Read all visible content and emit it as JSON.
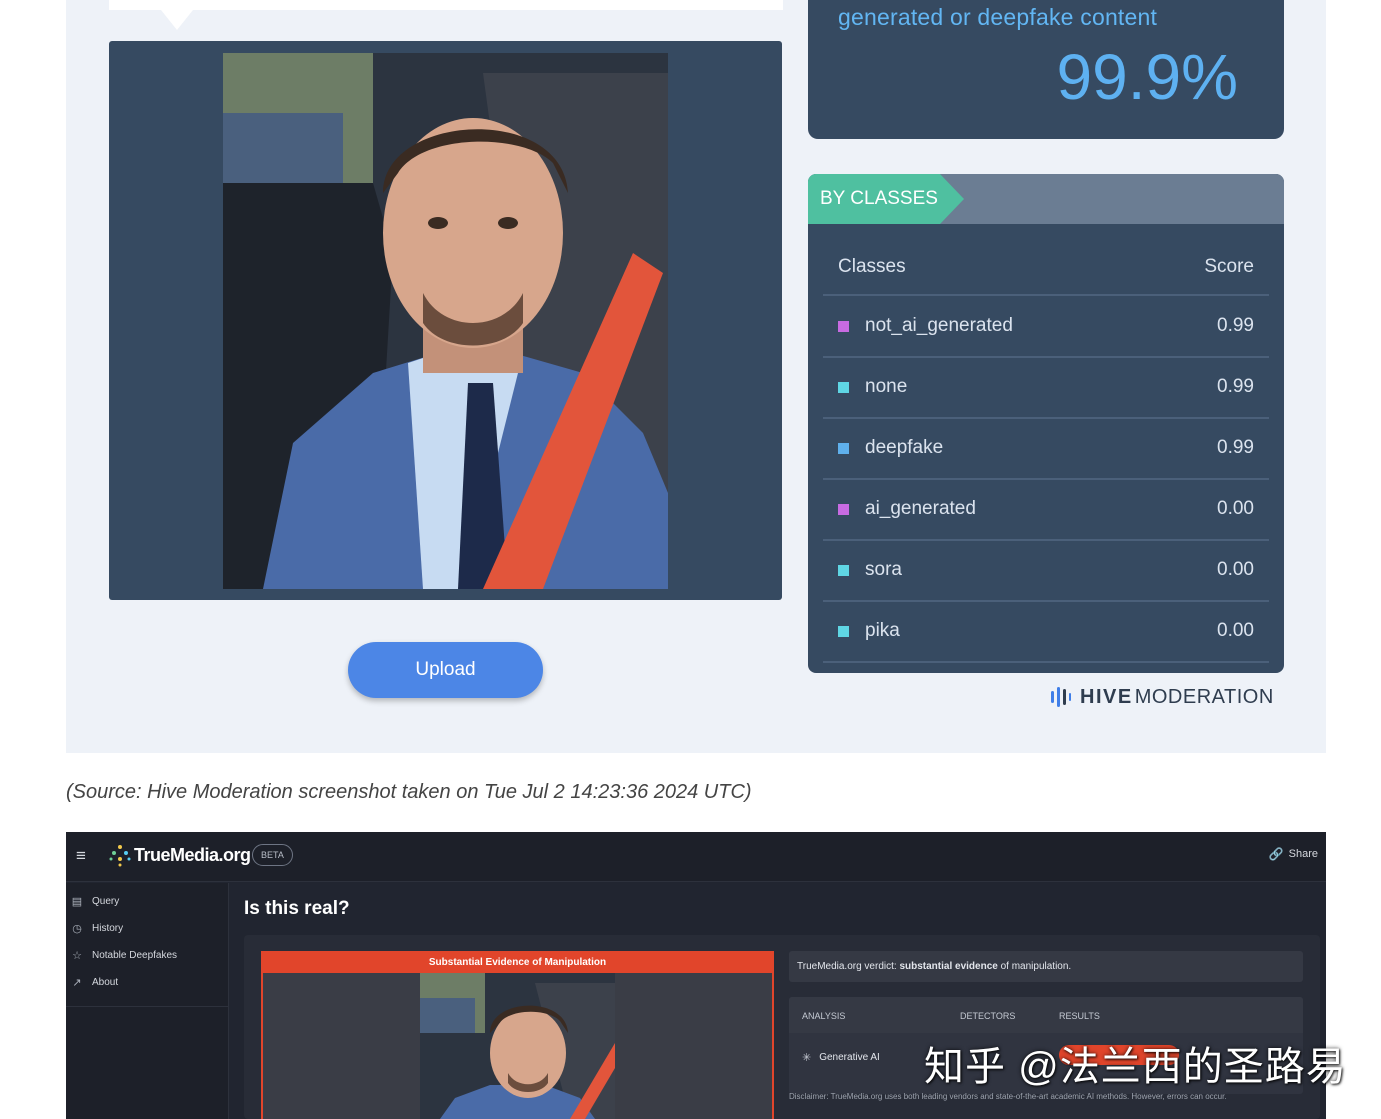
{
  "hive": {
    "score_caption": "generated or deepfake content",
    "score_value": "99.9%",
    "upload_label": "Upload",
    "classes_tag": "BY CLASSES",
    "table_headers": {
      "classes": "Classes",
      "score": "Score"
    },
    "rows": [
      {
        "name": "not_ai_generated",
        "score": "0.99",
        "color": "#c86be2"
      },
      {
        "name": "none",
        "score": "0.99",
        "color": "#5fd6e4"
      },
      {
        "name": "deepfake",
        "score": "0.99",
        "color": "#5fb0ec"
      },
      {
        "name": "ai_generated",
        "score": "0.00",
        "color": "#c86be2"
      },
      {
        "name": "sora",
        "score": "0.00",
        "color": "#5fd6e4"
      },
      {
        "name": "pika",
        "score": "0.00",
        "color": "#5fd6e4"
      }
    ],
    "brand_strong": "HIVE",
    "brand_light": "MODERATION"
  },
  "source_caption": "(Source: Hive Moderation screenshot taken on Tue Jul 2 14:23:36 2024 UTC)",
  "truemedia": {
    "logo": "TrueMedia.org",
    "beta": "BETA",
    "share": "Share",
    "nav": [
      {
        "label": "Query",
        "icon": "query-icon"
      },
      {
        "label": "History",
        "icon": "history-icon"
      },
      {
        "label": "Notable Deepfakes",
        "icon": "star-icon"
      },
      {
        "label": "About",
        "icon": "external-link-icon"
      }
    ],
    "title": "Is this real?",
    "banner": "Substantial Evidence of Manipulation",
    "verdict_prefix": "TrueMedia.org verdict: ",
    "verdict_strong": "substantial evidence",
    "verdict_suffix": " of manipulation.",
    "analysis_headers": {
      "analysis": "ANALYSIS",
      "detectors": "DETECTORS",
      "results": "RESULTS"
    },
    "analysis_row": "Generative AI",
    "disclaimer": "Disclaimer: TrueMedia.org uses both leading vendors and state-of-the-art academic AI methods. However, errors can occur."
  },
  "watermark": "知乎 @法兰西的圣路易",
  "colors": {
    "hive_panel": "#364a61",
    "hive_accent": "#4fc0a0",
    "tm_alert": "#e1452b",
    "upload": "#4c86e6"
  }
}
